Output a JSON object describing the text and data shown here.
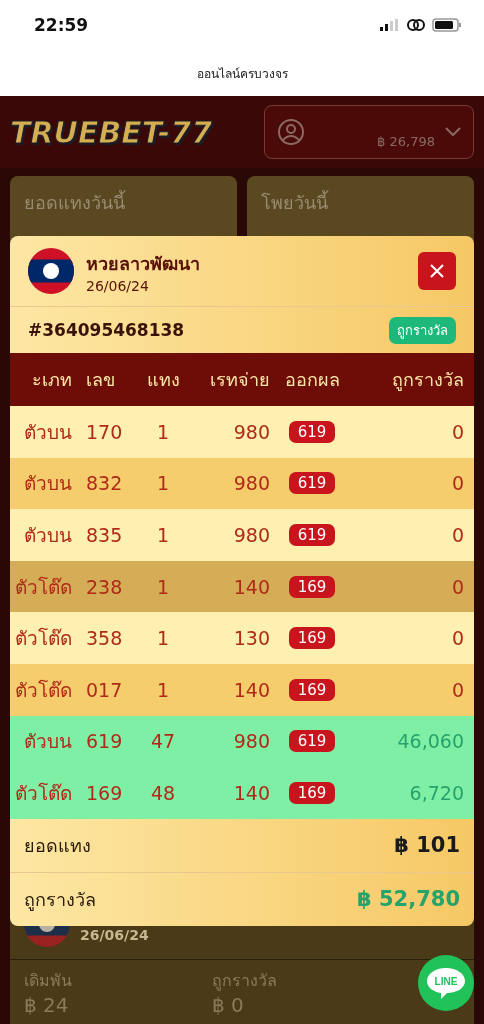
{
  "status_bar": {
    "time": "22:59"
  },
  "browser": {
    "title": "ออนไลน์ครบวงจร"
  },
  "header": {
    "logo": "TRUEBET-77",
    "balance": "฿ 26,798"
  },
  "stats": [
    {
      "label": "ยอดแทงวันนี้"
    },
    {
      "label": "โพยวันนี้"
    }
  ],
  "modal": {
    "title": "หวยลาวพัฒนา",
    "date": "26/06/24",
    "ticket": "#364095468138",
    "status": "ถูกรางวัล",
    "columns": [
      "ะเภท",
      "เลข",
      "แทง",
      "เรทจ่าย",
      "ออกผล",
      "ถูกรางวัล"
    ],
    "rows": [
      {
        "type": "ตัวบน",
        "number": "170",
        "bet": "1",
        "rate": "980",
        "result": "619",
        "prize": "0",
        "won": false,
        "selected": false
      },
      {
        "type": "ตัวบน",
        "number": "832",
        "bet": "1",
        "rate": "980",
        "result": "619",
        "prize": "0",
        "won": false,
        "selected": false
      },
      {
        "type": "ตัวบน",
        "number": "835",
        "bet": "1",
        "rate": "980",
        "result": "619",
        "prize": "0",
        "won": false,
        "selected": false
      },
      {
        "type": "ตัวโต๊ด",
        "number": "238",
        "bet": "1",
        "rate": "140",
        "result": "169",
        "prize": "0",
        "won": false,
        "selected": true
      },
      {
        "type": "ตัวโต๊ด",
        "number": "358",
        "bet": "1",
        "rate": "130",
        "result": "169",
        "prize": "0",
        "won": false,
        "selected": false
      },
      {
        "type": "ตัวโต๊ด",
        "number": "017",
        "bet": "1",
        "rate": "140",
        "result": "169",
        "prize": "0",
        "won": false,
        "selected": false
      },
      {
        "type": "ตัวบน",
        "number": "619",
        "bet": "47",
        "rate": "980",
        "result": "619",
        "prize": "46,060",
        "won": true,
        "selected": false
      },
      {
        "type": "ตัวโต๊ด",
        "number": "169",
        "bet": "48",
        "rate": "140",
        "result": "169",
        "prize": "6,720",
        "won": true,
        "selected": false
      }
    ],
    "totals": [
      {
        "label": "ยอดแทง",
        "value": "฿ 101",
        "kind": "stake"
      },
      {
        "label": "ถูกรางวัล",
        "value": "฿ 52,780",
        "kind": "prize"
      }
    ]
  },
  "background_ticket": {
    "date": "26/06/24",
    "stats": [
      {
        "label": "เดิมพัน",
        "value": "฿ 24"
      },
      {
        "label": "ถูกรางวัล",
        "value": "฿ 0"
      }
    ]
  },
  "line_button": {
    "label": "LINE"
  }
}
